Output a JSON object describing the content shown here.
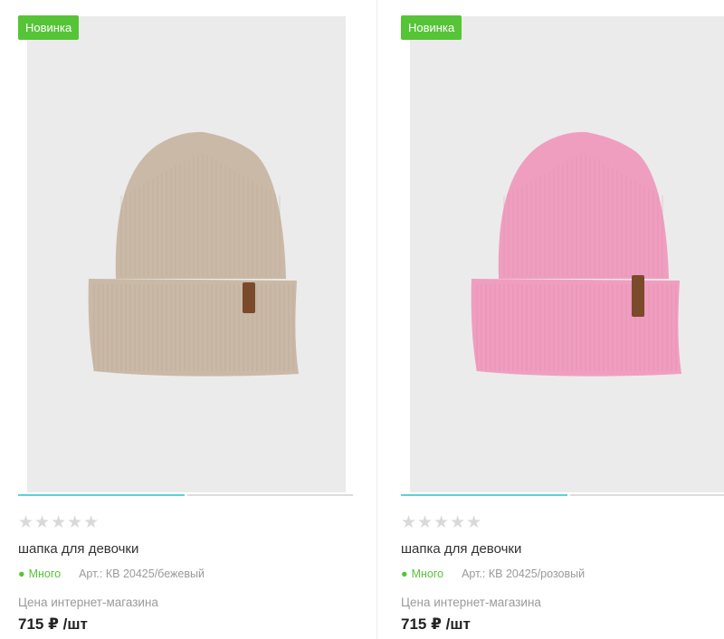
{
  "products": [
    {
      "badge": "Новинка",
      "stars": "★★★★★",
      "name": "шапка для девочки",
      "stock_label": "Много",
      "article": "Арт.: КВ 20425/бежевый",
      "price_label": "Цена интернет-магазина",
      "price": "715 ₽ /шт",
      "hat_color": "#c9b9a6",
      "rib_color": "#b5a491",
      "image_index": 1,
      "image_count": 2
    },
    {
      "badge": "Новинка",
      "stars": "★★★★★",
      "name": "шапка для девочки",
      "stock_label": "Много",
      "article": "Арт.: КВ 20425/розовый",
      "price_label": "Цена интернет-магазина",
      "price": "715 ₽ /шт",
      "hat_color": "#f09ec0",
      "rib_color": "#dd85a9",
      "image_index": 1,
      "image_count": 2
    }
  ],
  "colors": {
    "badge_green": "#56c437",
    "slider_active": "#5fd0d5",
    "image_bg": "#ebebeb",
    "label_tag": "#7a4a2b"
  },
  "icons": {
    "rating": "star-icon",
    "stock_dot": "dot-icon"
  }
}
